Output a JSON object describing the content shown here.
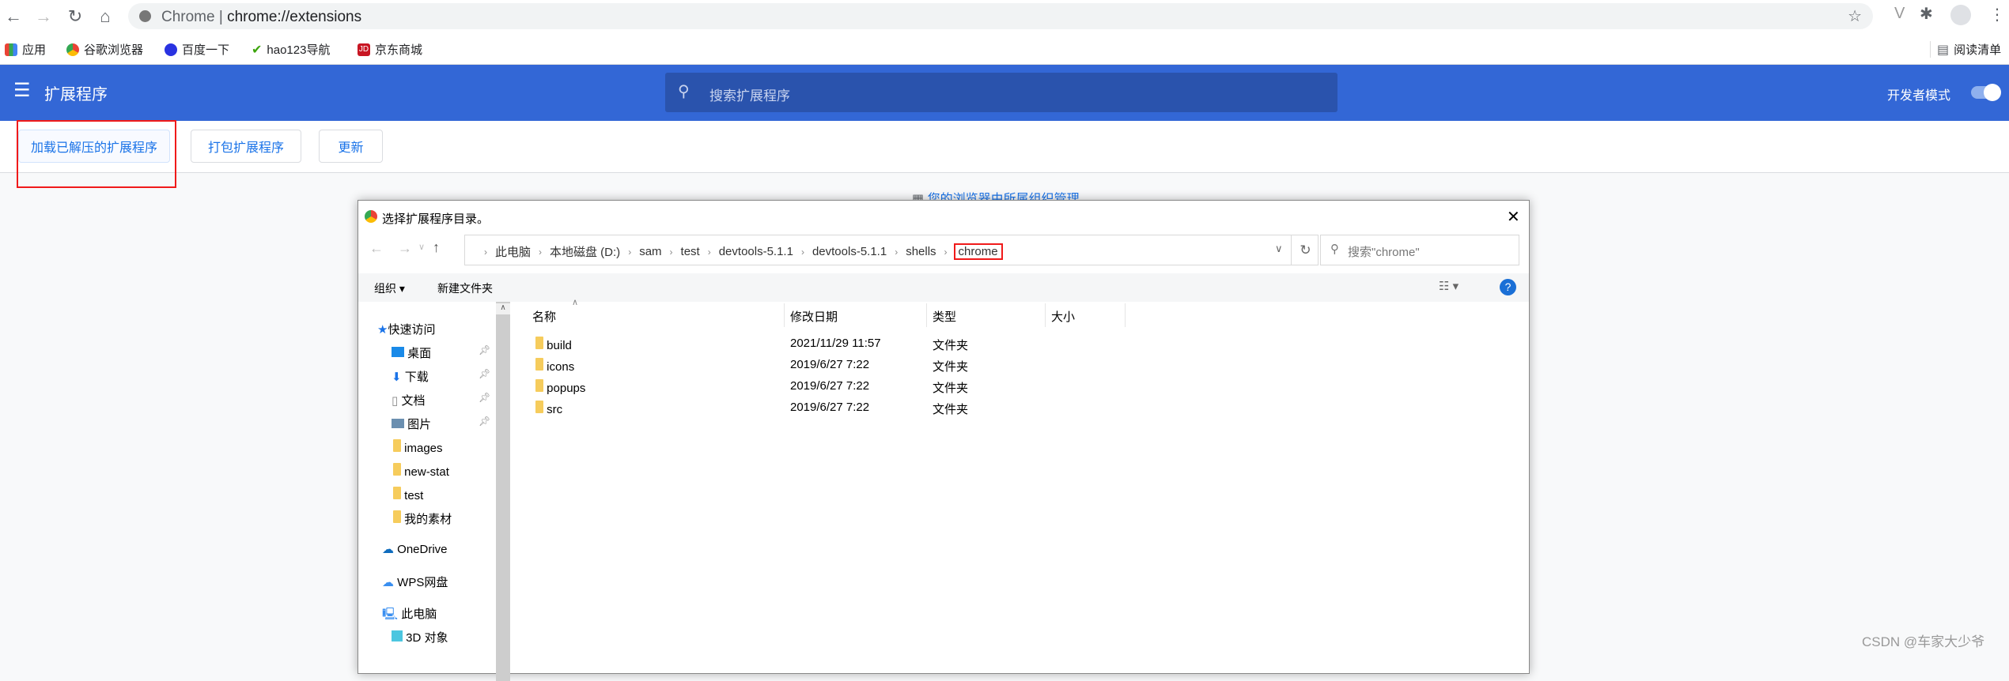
{
  "browser": {
    "omnibox_site": "Chrome",
    "omnibox_url": "chrome://extensions",
    "bookmarks": [
      {
        "label": "应用",
        "icon": "apps-icon"
      },
      {
        "label": "谷歌浏览器",
        "icon": "chrome-icon"
      },
      {
        "label": "百度一下",
        "icon": "baidu-icon"
      },
      {
        "label": "hao123导航",
        "icon": "hao123-icon"
      },
      {
        "label": "京东商城",
        "icon": "jd-icon"
      }
    ],
    "reading_list": "阅读清单"
  },
  "extensions": {
    "title": "扩展程序",
    "search_placeholder": "搜索扩展程序",
    "dev_mode_label": "开发者模式",
    "dev_mode_on": true,
    "buttons": [
      "加载已解压的扩展程序",
      "打包扩展程序",
      "更新"
    ],
    "managed_notice": "您的浏览器由所属组织管理",
    "accent": "#3367d6"
  },
  "dialog": {
    "title": "选择扩展程序目录。",
    "breadcrumb": [
      "此电脑",
      "本地磁盘 (D:)",
      "sam",
      "test",
      "devtools-5.1.1",
      "devtools-5.1.1",
      "shells",
      "chrome"
    ],
    "search_placeholder": "搜索\"chrome\"",
    "toolbar": {
      "organize": "组织",
      "new_folder": "新建文件夹"
    },
    "nav": [
      {
        "label": "快速访问",
        "icon": "star-icon"
      },
      {
        "label": "桌面",
        "icon": "desktop-icon",
        "pinned": true
      },
      {
        "label": "下载",
        "icon": "download-icon",
        "pinned": true
      },
      {
        "label": "文档",
        "icon": "document-icon",
        "pinned": true
      },
      {
        "label": "图片",
        "icon": "picture-icon",
        "pinned": true
      },
      {
        "label": "images",
        "icon": "folder-icon"
      },
      {
        "label": "new-stat",
        "icon": "folder-icon"
      },
      {
        "label": "test",
        "icon": "folder-icon"
      },
      {
        "label": "我的素材",
        "icon": "folder-icon"
      },
      {
        "label": "OneDrive",
        "icon": "cloud-icon"
      },
      {
        "label": "WPS网盘",
        "icon": "cloud-icon"
      },
      {
        "label": "此电脑",
        "icon": "computer-icon"
      },
      {
        "label": "3D 对象",
        "icon": "cube-icon"
      }
    ],
    "columns": [
      "名称",
      "修改日期",
      "类型",
      "大小"
    ],
    "files": [
      {
        "name": "build",
        "date": "2021/11/29 11:57",
        "type": "文件夹"
      },
      {
        "name": "icons",
        "date": "2019/6/27 7:22",
        "type": "文件夹"
      },
      {
        "name": "popups",
        "date": "2019/6/27 7:22",
        "type": "文件夹"
      },
      {
        "name": "src",
        "date": "2019/6/27 7:22",
        "type": "文件夹"
      }
    ]
  },
  "watermark": "CSDN @车家大少爷"
}
